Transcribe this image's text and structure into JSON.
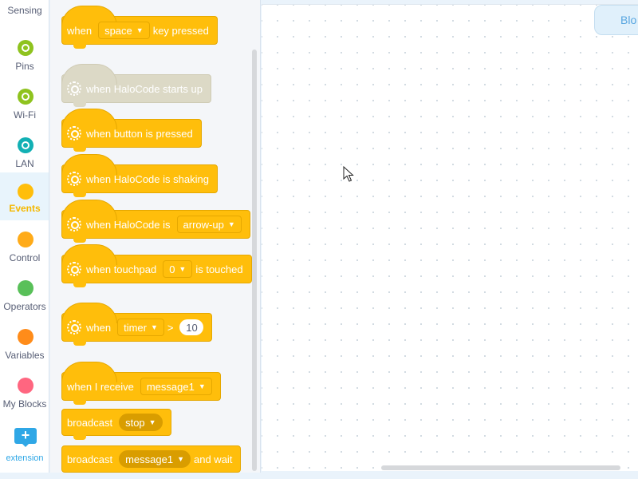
{
  "sidebar": {
    "partial_top_label": "Sensing",
    "categories": [
      {
        "label": "Pins",
        "color": "#8fc31f",
        "icon": "gear"
      },
      {
        "label": "Wi-Fi",
        "color": "#8fc31f",
        "icon": "gear"
      },
      {
        "label": "LAN",
        "color": "#12b0b4",
        "icon": "gear"
      },
      {
        "label": "Events",
        "color": "#ffbe0b",
        "icon": "dot"
      },
      {
        "label": "Control",
        "color": "#ffab19",
        "icon": "dot"
      },
      {
        "label": "Operators",
        "color": "#59c059",
        "icon": "dot"
      },
      {
        "label": "Variables",
        "color": "#ff8c1a",
        "icon": "dot"
      },
      {
        "label": "My Blocks",
        "color": "#ff6680",
        "icon": "dot"
      }
    ],
    "extension_label": "extension",
    "extension_icon": "+"
  },
  "blocks": {
    "key_pressed": {
      "when": "when",
      "key": "space",
      "tail": "key pressed"
    },
    "starts_up": {
      "text": "when HaloCode starts up"
    },
    "button_pressed": {
      "text": "when button is pressed"
    },
    "shaking": {
      "text": "when HaloCode is shaking"
    },
    "tilted": {
      "text": "when HaloCode is",
      "option": "arrow-up"
    },
    "touchpad": {
      "text": "when touchpad",
      "option": "0",
      "tail": "is touched"
    },
    "timer": {
      "text": "when",
      "option": "timer",
      "op": ">",
      "value": "10"
    },
    "receive": {
      "text": "when I receive",
      "option": "message1"
    },
    "broadcast": {
      "text": "broadcast",
      "option": "stop"
    },
    "broadcast_wait": {
      "text": "broadcast",
      "option": "message1",
      "tail": "and wait"
    }
  },
  "tabs": {
    "blocks_tab": "Blo"
  },
  "colors": {
    "event_block": "#ffbe0b",
    "disabled_block": "#dcd9c6",
    "accent": "#2fa7e6"
  }
}
